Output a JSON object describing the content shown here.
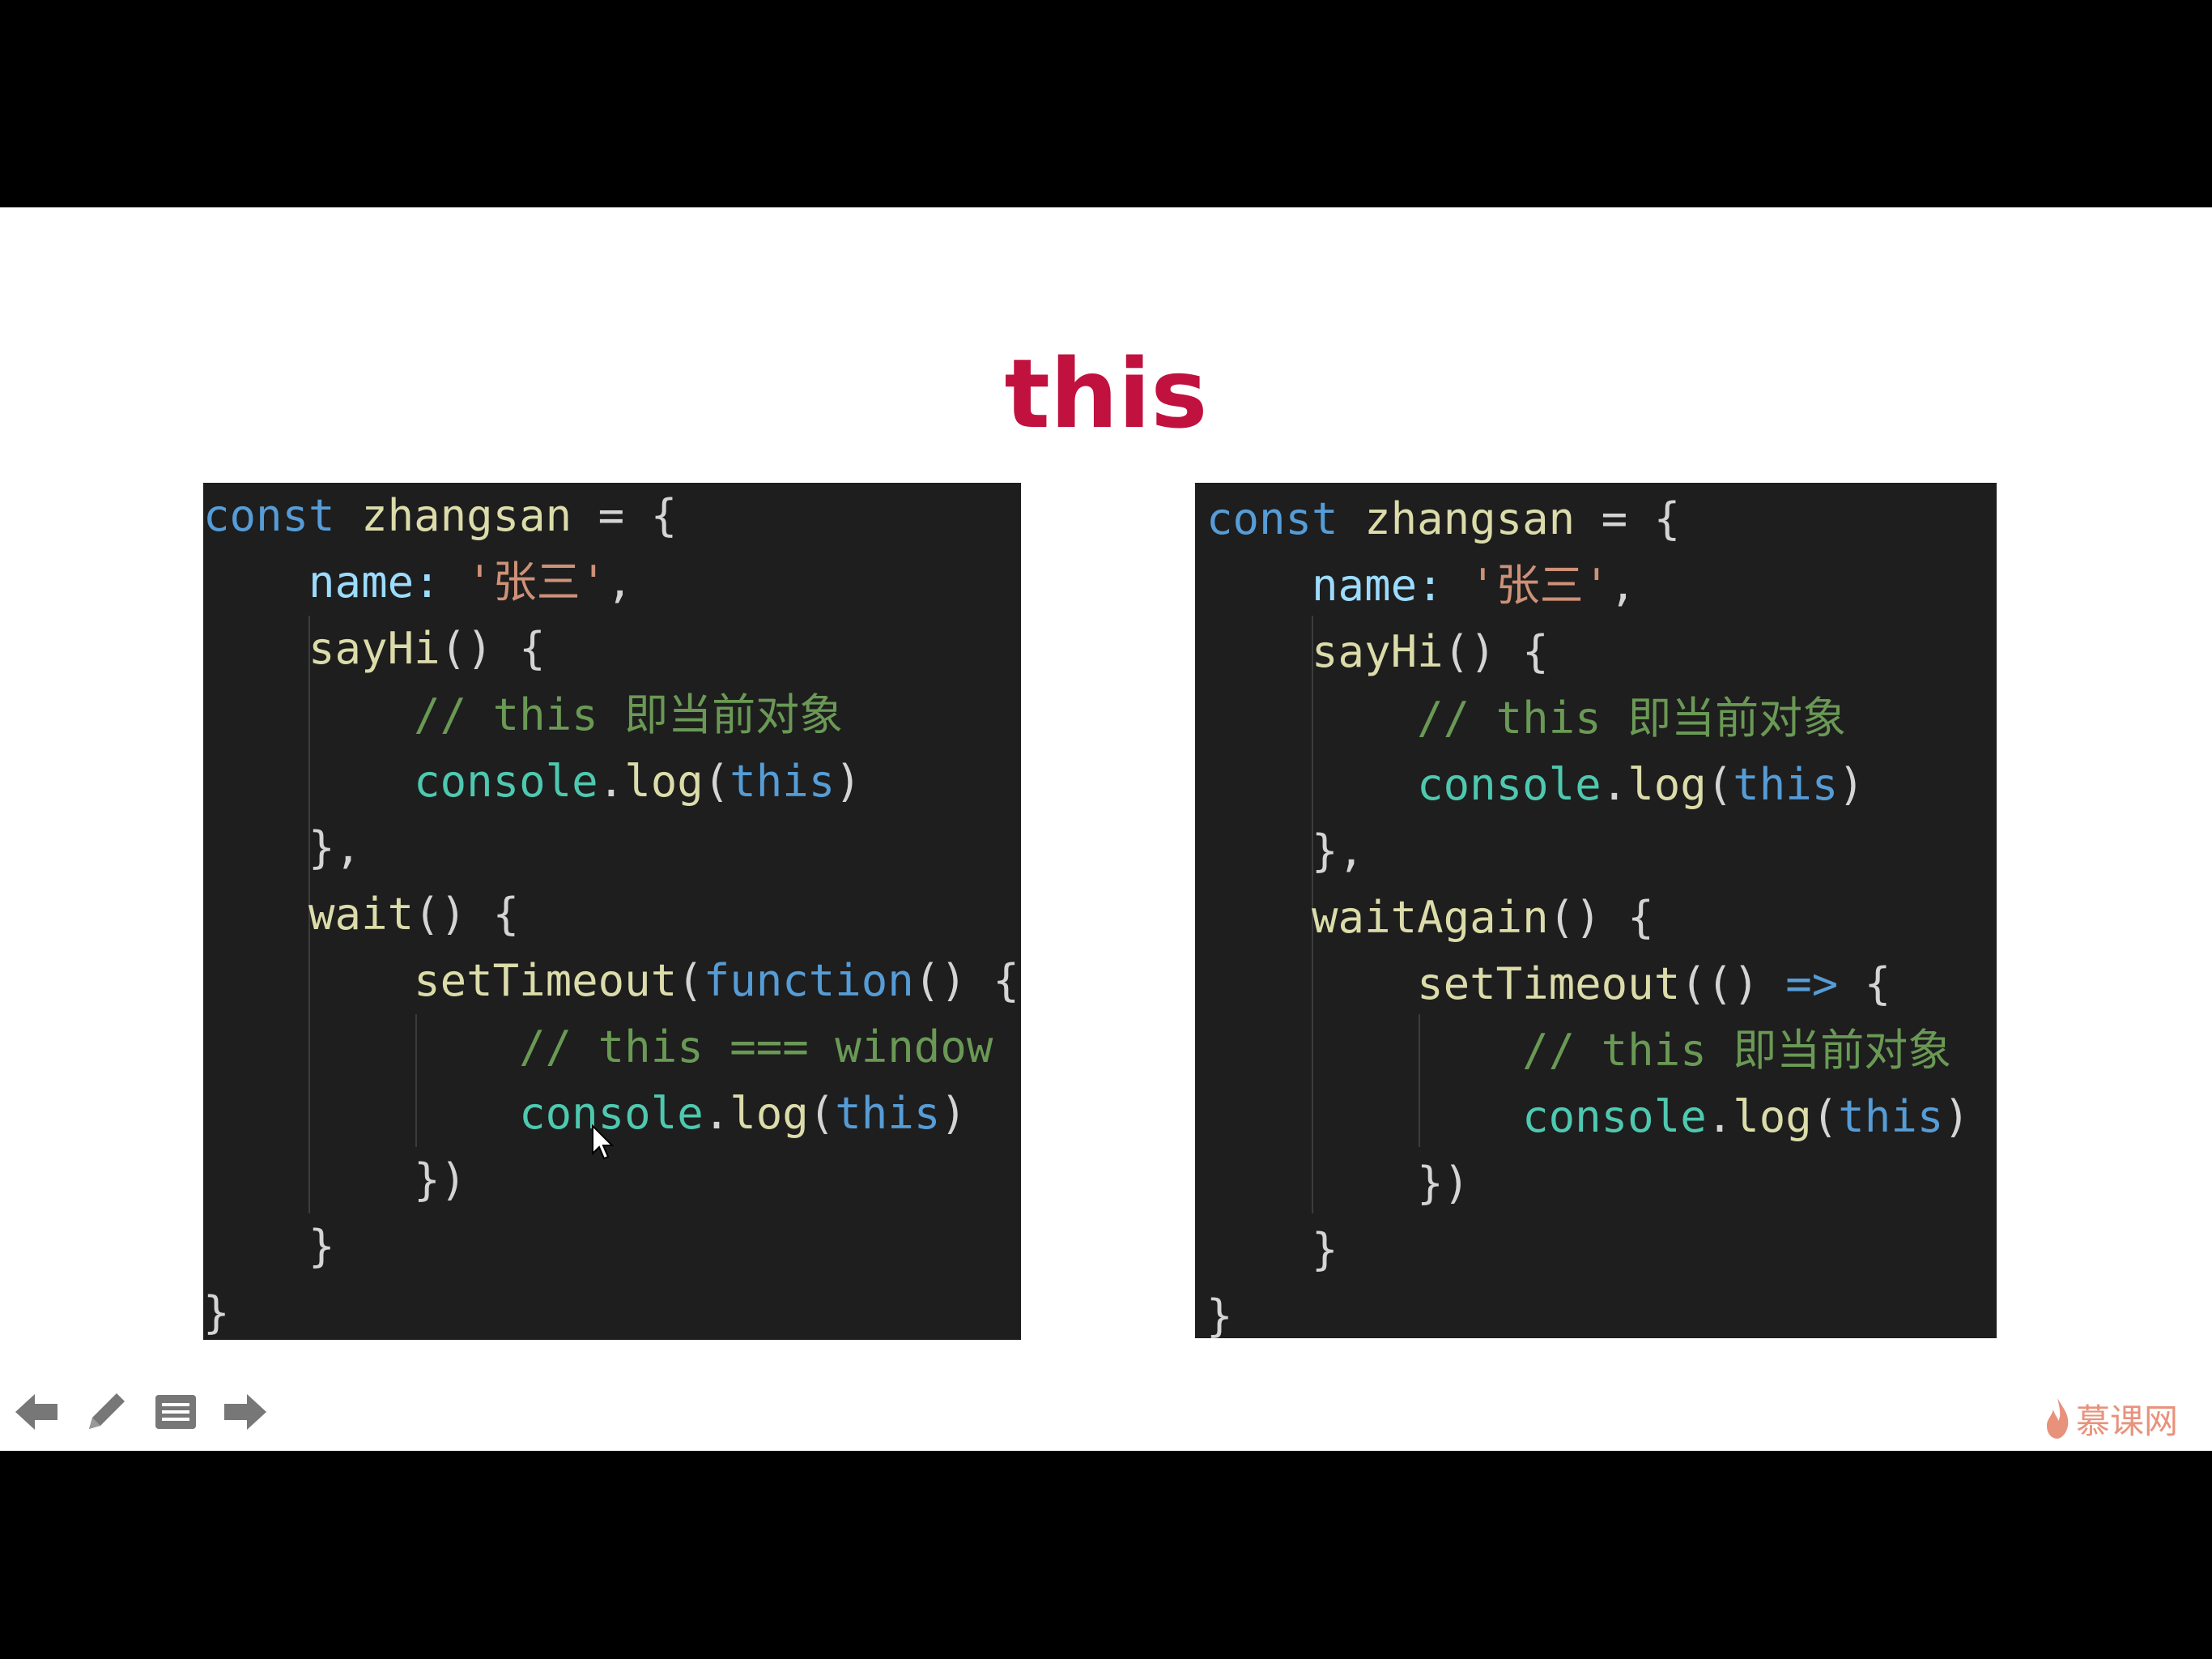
{
  "slide": {
    "title": "this"
  },
  "left_code": {
    "lines": [
      [
        "const",
        " ",
        "zhangsan",
        " = {"
      ],
      [
        "    ",
        "name",
        ": ",
        "'张三'",
        ","
      ],
      [
        "    ",
        "sayHi",
        "() {"
      ],
      [
        "        ",
        "// this 即当前对象"
      ],
      [
        "        ",
        "console",
        ".",
        "log",
        "(",
        "this",
        ")"
      ],
      [
        "    ",
        "},"
      ],
      [
        "    ",
        "wait",
        "() {"
      ],
      [
        "        ",
        "setTimeout",
        "(",
        "function",
        "() {"
      ],
      [
        "            ",
        "// this === window"
      ],
      [
        "            ",
        "console",
        ".",
        "log",
        "(",
        "this",
        ")"
      ],
      [
        "        ",
        "})"
      ],
      [
        "    ",
        "}"
      ],
      [
        "}"
      ]
    ]
  },
  "right_code": {
    "lines": [
      [
        "const",
        " ",
        "zhangsan",
        " = {"
      ],
      [
        "    ",
        "name",
        ": ",
        "'张三'",
        ","
      ],
      [
        "    ",
        "sayHi",
        "() {"
      ],
      [
        "        ",
        "// this 即当前对象"
      ],
      [
        "        ",
        "console",
        ".",
        "log",
        "(",
        "this",
        ")"
      ],
      [
        "    ",
        "},"
      ],
      [
        "    ",
        "waitAgain",
        "() {"
      ],
      [
        "        ",
        "setTimeout",
        "((",
        ") ",
        "=>",
        " {"
      ],
      [
        "            ",
        "// this 即当前对象"
      ],
      [
        "            ",
        "console",
        ".",
        "log",
        "(",
        "this",
        ")"
      ],
      [
        "        ",
        "})"
      ],
      [
        "    ",
        "}"
      ],
      [
        "}"
      ]
    ]
  },
  "toolbar": {
    "icons": [
      "arrow-left-icon",
      "pencil-icon",
      "notes-icon",
      "arrow-right-icon"
    ]
  },
  "logo": {
    "text": "慕课网",
    "icon": "flame-icon",
    "color": "#e8927c"
  },
  "colors": {
    "title": "#c0113f",
    "keyword": "#569cd6",
    "variable": "#9cdcfe",
    "function": "#dcdcaa",
    "string": "#ce9178",
    "comment": "#6a9955",
    "object": "#4ec9b0",
    "panel_bg": "#1e1e1e"
  }
}
